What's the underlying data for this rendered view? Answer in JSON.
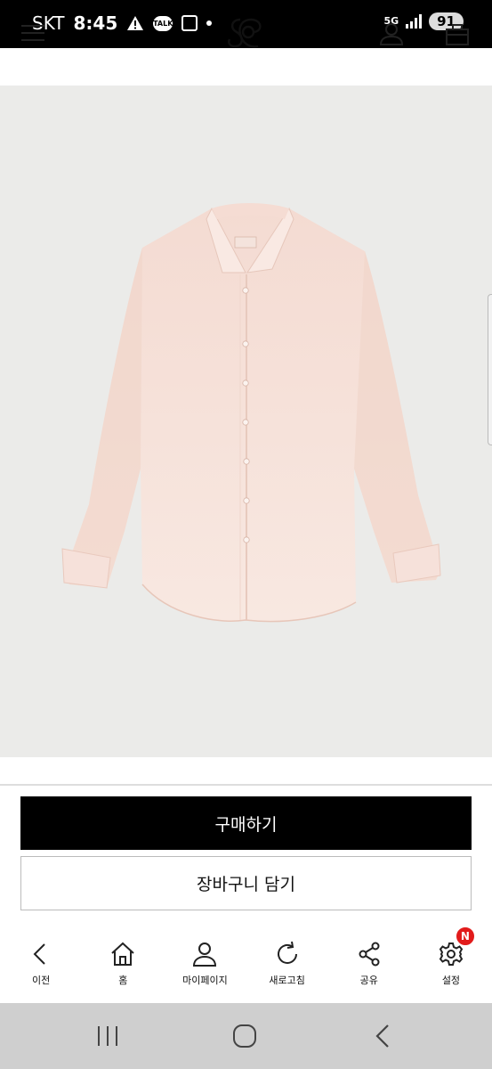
{
  "status_bar": {
    "carrier": "SKT",
    "time": "8:45",
    "talk_badge": "TALK",
    "network": "5G",
    "battery": "91",
    "icons": [
      "warning-icon",
      "kakaotalk-icon",
      "screenshot-icon",
      "dot-icon",
      "network-5g-icon",
      "signal-icon",
      "battery-icon"
    ]
  },
  "header": {
    "icons": [
      "menu-icon",
      "brand-logo",
      "user-icon",
      "shopping-bag-icon"
    ]
  },
  "product": {
    "image": "pink-shirt-photo",
    "background_color": "#ebebe9",
    "shirt_color": "#f5e1d9"
  },
  "actions": {
    "buy_label": "구매하기",
    "cart_label": "장바구니 담기"
  },
  "toolbar": {
    "items": [
      {
        "label": "이전",
        "icon": "back-icon"
      },
      {
        "label": "홈",
        "icon": "home-icon"
      },
      {
        "label": "마이페이지",
        "icon": "person-icon"
      },
      {
        "label": "새로고침",
        "icon": "refresh-icon"
      },
      {
        "label": "공유",
        "icon": "share-icon"
      },
      {
        "label": "설정",
        "icon": "gear-icon",
        "badge": "N"
      }
    ]
  },
  "android_nav": {
    "icons": [
      "recent-apps-icon",
      "home-circle-icon",
      "back-chevron-icon"
    ]
  },
  "colors": {
    "primary": "#000000",
    "badge": "#e21b1b",
    "nav_bar": "#cfcfcf"
  }
}
